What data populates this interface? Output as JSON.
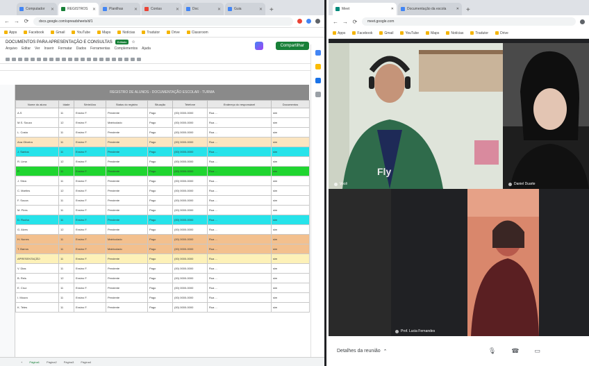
{
  "left_browser": {
    "tabs": [
      {
        "label": "Computador",
        "color": "#4285f4"
      },
      {
        "label": "REGISTROS",
        "color": "#188038",
        "active": true
      },
      {
        "label": "Planilhas",
        "color": "#4285f4"
      },
      {
        "label": "Contas",
        "color": "#ea4335"
      },
      {
        "label": "Doc",
        "color": "#4285f4"
      },
      {
        "label": "Guia",
        "color": "#4285f4"
      }
    ],
    "url": "docs.google.com/spreadsheets/d/1",
    "bookmarks": [
      "Apps",
      "Facebook",
      "Gmail",
      "YouTube",
      "Maps",
      "Notícias",
      "Tradutor",
      "Drive",
      "Classroom"
    ]
  },
  "sheet": {
    "title": "DOCUMENTOS PARA APRESENTAÇÃO E CONSULTAS",
    "badge": "Editado",
    "menu": [
      "Arquivo",
      "Editar",
      "Ver",
      "Inserir",
      "Formatar",
      "Dados",
      "Ferramentas",
      "Complementos",
      "Ajuda"
    ],
    "share_label": "Compartilhar",
    "banner": "REGISTRO DE ALUNOS - DOCUMENTAÇÃO ESCOLAR - TURMA",
    "columns": [
      "Nome do aluno",
      "Idade",
      "Série/Ano",
      "Status do registro",
      "Situação",
      "Telefone",
      "Endereço do responsável",
      "Documentos"
    ],
    "rows": [
      {
        "style": "white",
        "cells": [
          "A.S",
          "11",
          "Ensino F.",
          "Pendente",
          "Pago",
          "(00) 0000-0000",
          "Rua ...",
          "sim"
        ]
      },
      {
        "style": "white",
        "cells": [
          "M.S. Souza",
          "12",
          "Ensino F.",
          "Matriculado",
          "Pago",
          "(00) 0000-0000",
          "Rua ...",
          "sim"
        ]
      },
      {
        "style": "white",
        "cells": [
          "L. Costa",
          "11",
          "Ensino F.",
          "Pendente",
          "Pago",
          "(00) 0000-0000",
          "Rua ...",
          "sim"
        ]
      },
      {
        "style": "cream",
        "cells": [
          "Ana Oliveira",
          "11",
          "Ensino F.",
          "Pendente",
          "Pago",
          "(00) 0000-0000",
          "Rua ...",
          "sim"
        ]
      },
      {
        "style": "cyan",
        "cells": [
          "J. Santos",
          "11",
          "Ensino F.",
          "Pendente",
          "Pago",
          "(00) 0000-0000",
          "Rua ...",
          "sim"
        ]
      },
      {
        "style": "white",
        "cells": [
          "R. Lima",
          "12",
          "Ensino F.",
          "Pendente",
          "Pago",
          "(00) 0000-0000",
          "Rua ...",
          "sim"
        ]
      },
      {
        "style": "green",
        "cells": [
          "P.",
          "11",
          "Ensino F.",
          "Pendente",
          "Pago",
          "(00) 0000-0000",
          "Rua ...",
          "sim"
        ]
      },
      {
        "style": "white",
        "cells": [
          "J. Silva",
          "11",
          "Ensino F.",
          "Pendente",
          "Pago",
          "(00) 0000-0000",
          "Rua ...",
          "sim"
        ]
      },
      {
        "style": "white",
        "cells": [
          "C. Martins",
          "12",
          "Ensino F.",
          "Pendente",
          "Pago",
          "(00) 0000-0000",
          "Rua ...",
          "sim"
        ]
      },
      {
        "style": "white",
        "cells": [
          "F. Souza",
          "11",
          "Ensino F.",
          "Pendente",
          "Pago",
          "(00) 0000-0000",
          "Rua ...",
          "sim"
        ]
      },
      {
        "style": "white",
        "cells": [
          "M. Pires",
          "11",
          "Ensino F.",
          "Pendente",
          "Pago",
          "(00) 0000-0000",
          "Rua ...",
          "sim"
        ]
      },
      {
        "style": "cyan",
        "cells": [
          "D. Rocha",
          "11",
          "Ensino F.",
          "Pendente",
          "Pago",
          "(00) 0000-0000",
          "Rua ...",
          "sim"
        ]
      },
      {
        "style": "white",
        "cells": [
          "G. Alves",
          "12",
          "Ensino F.",
          "Pendente",
          "Pago",
          "(00) 0000-0000",
          "Rua ...",
          "sim"
        ]
      },
      {
        "style": "orange",
        "cells": [
          "H. Nunes",
          "11",
          "Ensino F.",
          "Matriculado",
          "Pago",
          "(00) 0000-0000",
          "Rua ...",
          "sim"
        ]
      },
      {
        "style": "orange",
        "cells": [
          "T. Barros",
          "11",
          "Ensino F.",
          "Matriculado",
          "Pago",
          "(00) 0000-0000",
          "Rua ...",
          "sim"
        ]
      },
      {
        "style": "yellow",
        "cells": [
          "APRESENTAÇÃO",
          "11",
          "Ensino F.",
          "Pendente",
          "Pago",
          "(00) 0000-0000",
          "Rua ...",
          "sim"
        ]
      },
      {
        "style": "white",
        "cells": [
          "V. Dias",
          "11",
          "Ensino F.",
          "Pendente",
          "Pago",
          "(00) 0000-0000",
          "Rua ...",
          "sim"
        ]
      },
      {
        "style": "white",
        "cells": [
          "B. Reis",
          "12",
          "Ensino F.",
          "Pendente",
          "Pago",
          "(00) 0000-0000",
          "Rua ...",
          "sim"
        ]
      },
      {
        "style": "white",
        "cells": [
          "E. Cruz",
          "11",
          "Ensino F.",
          "Pendente",
          "Pago",
          "(00) 0000-0000",
          "Rua ...",
          "sim"
        ]
      },
      {
        "style": "white",
        "cells": [
          "I. Moura",
          "11",
          "Ensino F.",
          "Pendente",
          "Pago",
          "(00) 0000-0000",
          "Rua ...",
          "sim"
        ]
      },
      {
        "style": "white",
        "cells": [
          "K. Teles",
          "11",
          "Ensino F.",
          "Pendente",
          "Pago",
          "(00) 0000-0000",
          "Rua ...",
          "sim"
        ]
      }
    ],
    "sheet_tabs": [
      "Página1",
      "Página2",
      "Página3",
      "Página4"
    ]
  },
  "right_browser": {
    "tabs": [
      {
        "label": "Meet",
        "color": "#00897b",
        "active": true
      },
      {
        "label": "Documentação da escola",
        "color": "#4285f4"
      }
    ],
    "url": "meet.google.com",
    "bookmarks": [
      "Apps",
      "Facebook",
      "Gmail",
      "YouTube",
      "Maps",
      "Notícias",
      "Tradutor",
      "Drive"
    ]
  },
  "meet": {
    "participants": [
      {
        "name": "Você"
      },
      {
        "name": "Daniel Duarte"
      },
      {
        "name": "Prof. Lucia Fernandes"
      }
    ],
    "details_label": "Detalhes da reunião"
  }
}
